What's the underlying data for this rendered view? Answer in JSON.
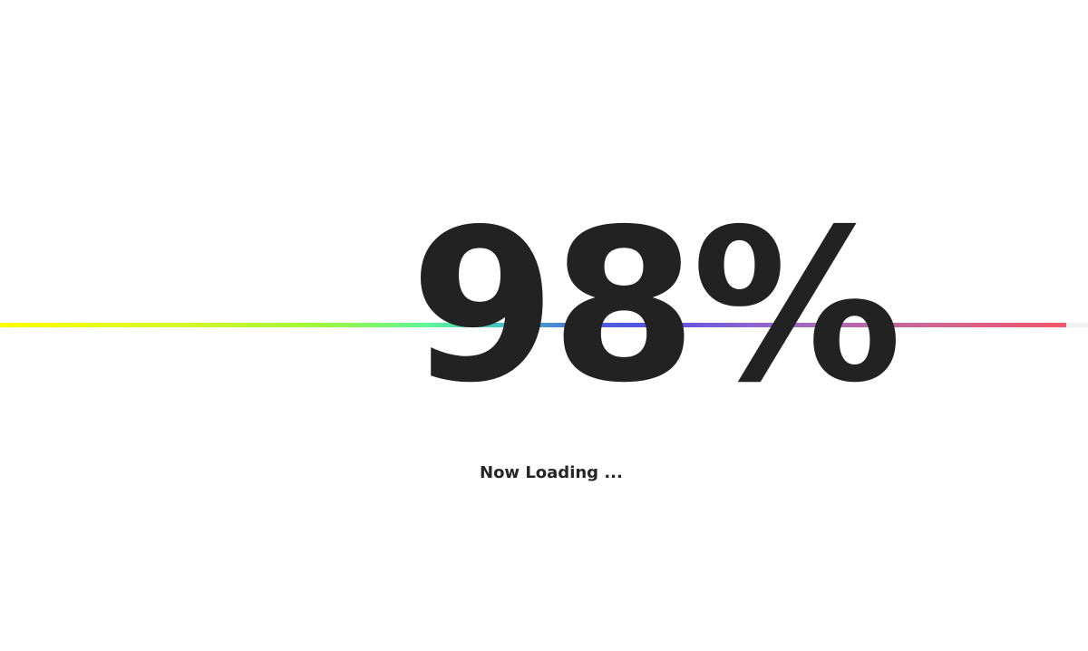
{
  "loader": {
    "progress_percent": 98,
    "percent_label": "98%",
    "status_text": "Now Loading ...",
    "colors": {
      "text": "#222222",
      "track": "#f1f1f1",
      "gradient_start": "#ffff00",
      "gradient_mid_green": "#5ef59a",
      "gradient_mid_blue": "#5a4fe6",
      "gradient_end": "#f4566a"
    }
  }
}
